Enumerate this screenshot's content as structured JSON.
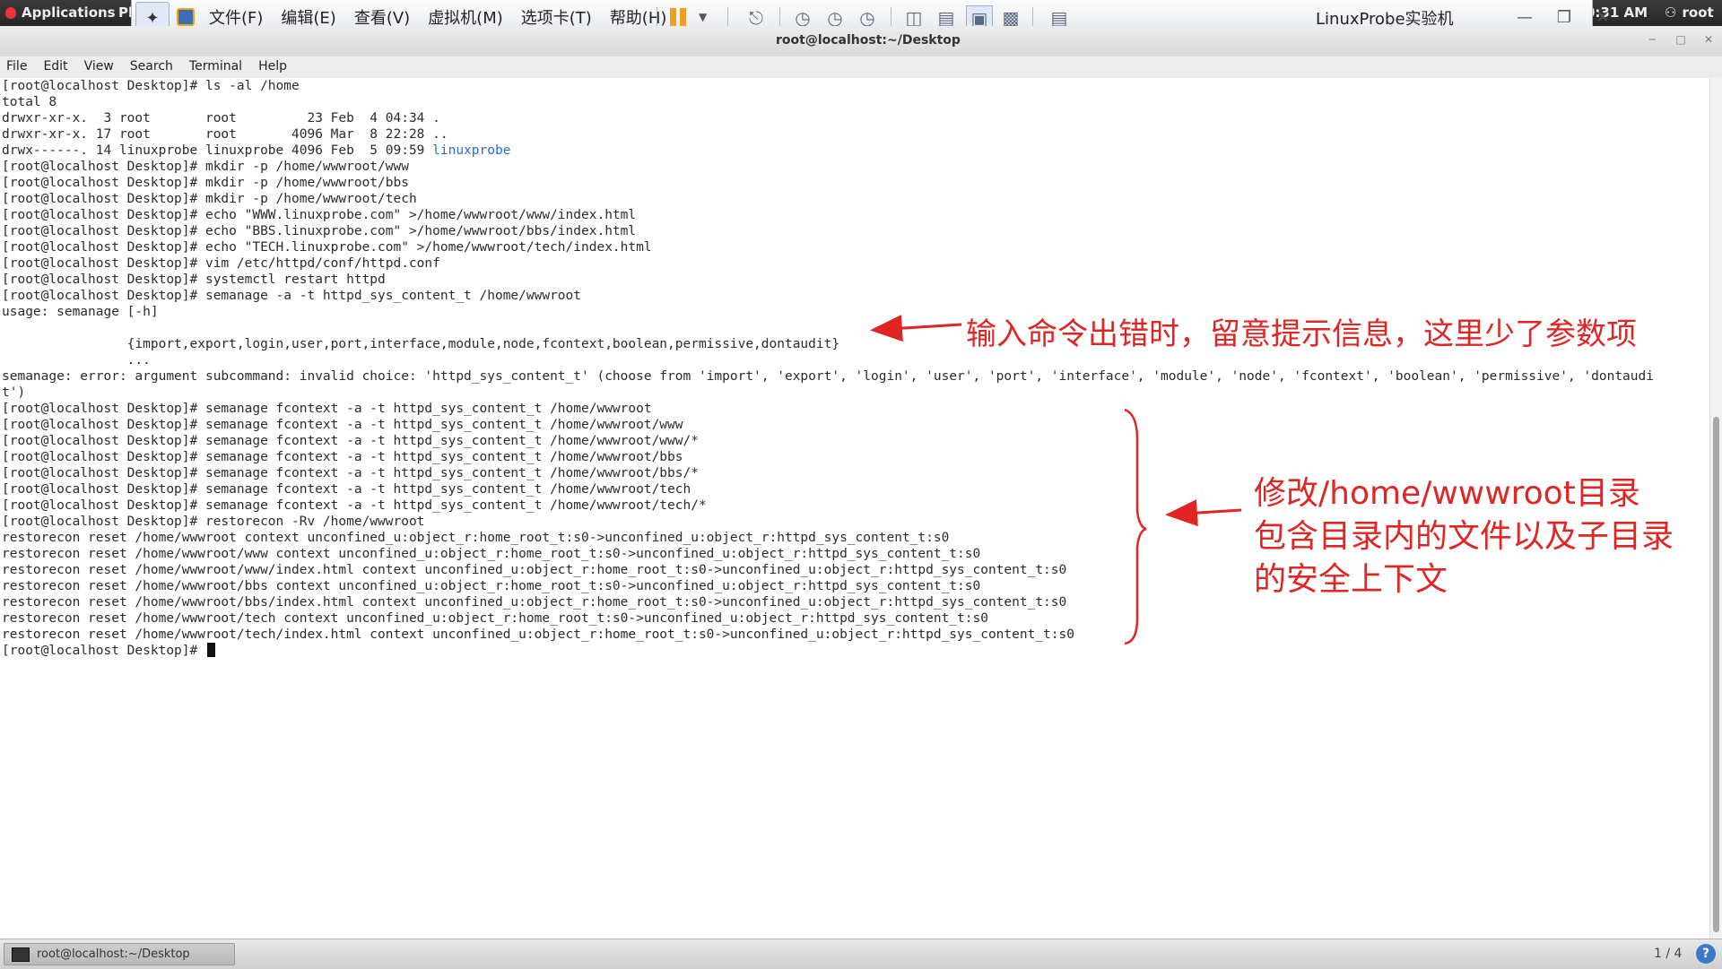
{
  "topbar": {
    "applications": "Applications",
    "places": "Pl",
    "clock": "0:31 AM",
    "user": "root"
  },
  "vmware": {
    "menus": [
      "文件(F)",
      "编辑(E)",
      "查看(V)",
      "虚拟机(M)",
      "选项卡(T)",
      "帮助(H)"
    ],
    "title": "LinuxProbe实验机"
  },
  "window": {
    "title": "root@localhost:~/Desktop"
  },
  "terminal_menu": [
    "File",
    "Edit",
    "View",
    "Search",
    "Terminal",
    "Help"
  ],
  "terminal": {
    "lines_before_dir": "[root@localhost Desktop]# ls -al /home\ntotal 8\ndrwxr-xr-x.  3 root       root         23 Feb  4 04:34 .\ndrwxr-xr-x. 17 root       root       4096 Mar  8 22:28 ..\ndrwx------. 14 linuxprobe linuxprobe 4096 Feb  5 09:59 ",
    "dir_name": "linuxprobe",
    "lines_after_dir": "\n[root@localhost Desktop]# mkdir -p /home/wwwroot/www\n[root@localhost Desktop]# mkdir -p /home/wwwroot/bbs\n[root@localhost Desktop]# mkdir -p /home/wwwroot/tech\n[root@localhost Desktop]# echo \"WWW.linuxprobe.com\" >/home/wwwroot/www/index.html\n[root@localhost Desktop]# echo \"BBS.linuxprobe.com\" >/home/wwwroot/bbs/index.html\n[root@localhost Desktop]# echo \"TECH.linuxprobe.com\" >/home/wwwroot/tech/index.html\n[root@localhost Desktop]# vim /etc/httpd/conf/httpd.conf\n[root@localhost Desktop]# systemctl restart httpd\n[root@localhost Desktop]# semanage -a -t httpd_sys_content_t /home/wwwroot\nusage: semanage [-h]\n\n                {import,export,login,user,port,interface,module,node,fcontext,boolean,permissive,dontaudit}\n                ...\nsemanage: error: argument subcommand: invalid choice: 'httpd_sys_content_t' (choose from 'import', 'export', 'login', 'user', 'port', 'interface', 'module', 'node', 'fcontext', 'boolean', 'permissive', 'dontaudi\nt')\n[root@localhost Desktop]# semanage fcontext -a -t httpd_sys_content_t /home/wwwroot\n[root@localhost Desktop]# semanage fcontext -a -t httpd_sys_content_t /home/wwwroot/www\n[root@localhost Desktop]# semanage fcontext -a -t httpd_sys_content_t /home/wwwroot/www/*\n[root@localhost Desktop]# semanage fcontext -a -t httpd_sys_content_t /home/wwwroot/bbs\n[root@localhost Desktop]# semanage fcontext -a -t httpd_sys_content_t /home/wwwroot/bbs/*\n[root@localhost Desktop]# semanage fcontext -a -t httpd_sys_content_t /home/wwwroot/tech\n[root@localhost Desktop]# semanage fcontext -a -t httpd_sys_content_t /home/wwwroot/tech/*\n[root@localhost Desktop]# restorecon -Rv /home/wwwroot\nrestorecon reset /home/wwwroot context unconfined_u:object_r:home_root_t:s0->unconfined_u:object_r:httpd_sys_content_t:s0\nrestorecon reset /home/wwwroot/www context unconfined_u:object_r:home_root_t:s0->unconfined_u:object_r:httpd_sys_content_t:s0\nrestorecon reset /home/wwwroot/www/index.html context unconfined_u:object_r:home_root_t:s0->unconfined_u:object_r:httpd_sys_content_t:s0\nrestorecon reset /home/wwwroot/bbs context unconfined_u:object_r:home_root_t:s0->unconfined_u:object_r:httpd_sys_content_t:s0\nrestorecon reset /home/wwwroot/bbs/index.html context unconfined_u:object_r:home_root_t:s0->unconfined_u:object_r:httpd_sys_content_t:s0\nrestorecon reset /home/wwwroot/tech context unconfined_u:object_r:home_root_t:s0->unconfined_u:object_r:httpd_sys_content_t:s0\nrestorecon reset /home/wwwroot/tech/index.html context unconfined_u:object_r:home_root_t:s0->unconfined_u:object_r:httpd_sys_content_t:s0\n",
    "prompt": "[root@localhost Desktop]# "
  },
  "annotations": {
    "note1": "输入命令出错时，留意提示信息，这里少了参数项",
    "note2_lines": [
      "修改/home/wwwroot目录",
      "包含目录内的文件以及子目录",
      "的安全上下文"
    ],
    "color": "#e02525"
  },
  "taskbar": {
    "task_label": "root@localhost:~/Desktop",
    "workspace": "1 / 4",
    "help": "?"
  }
}
